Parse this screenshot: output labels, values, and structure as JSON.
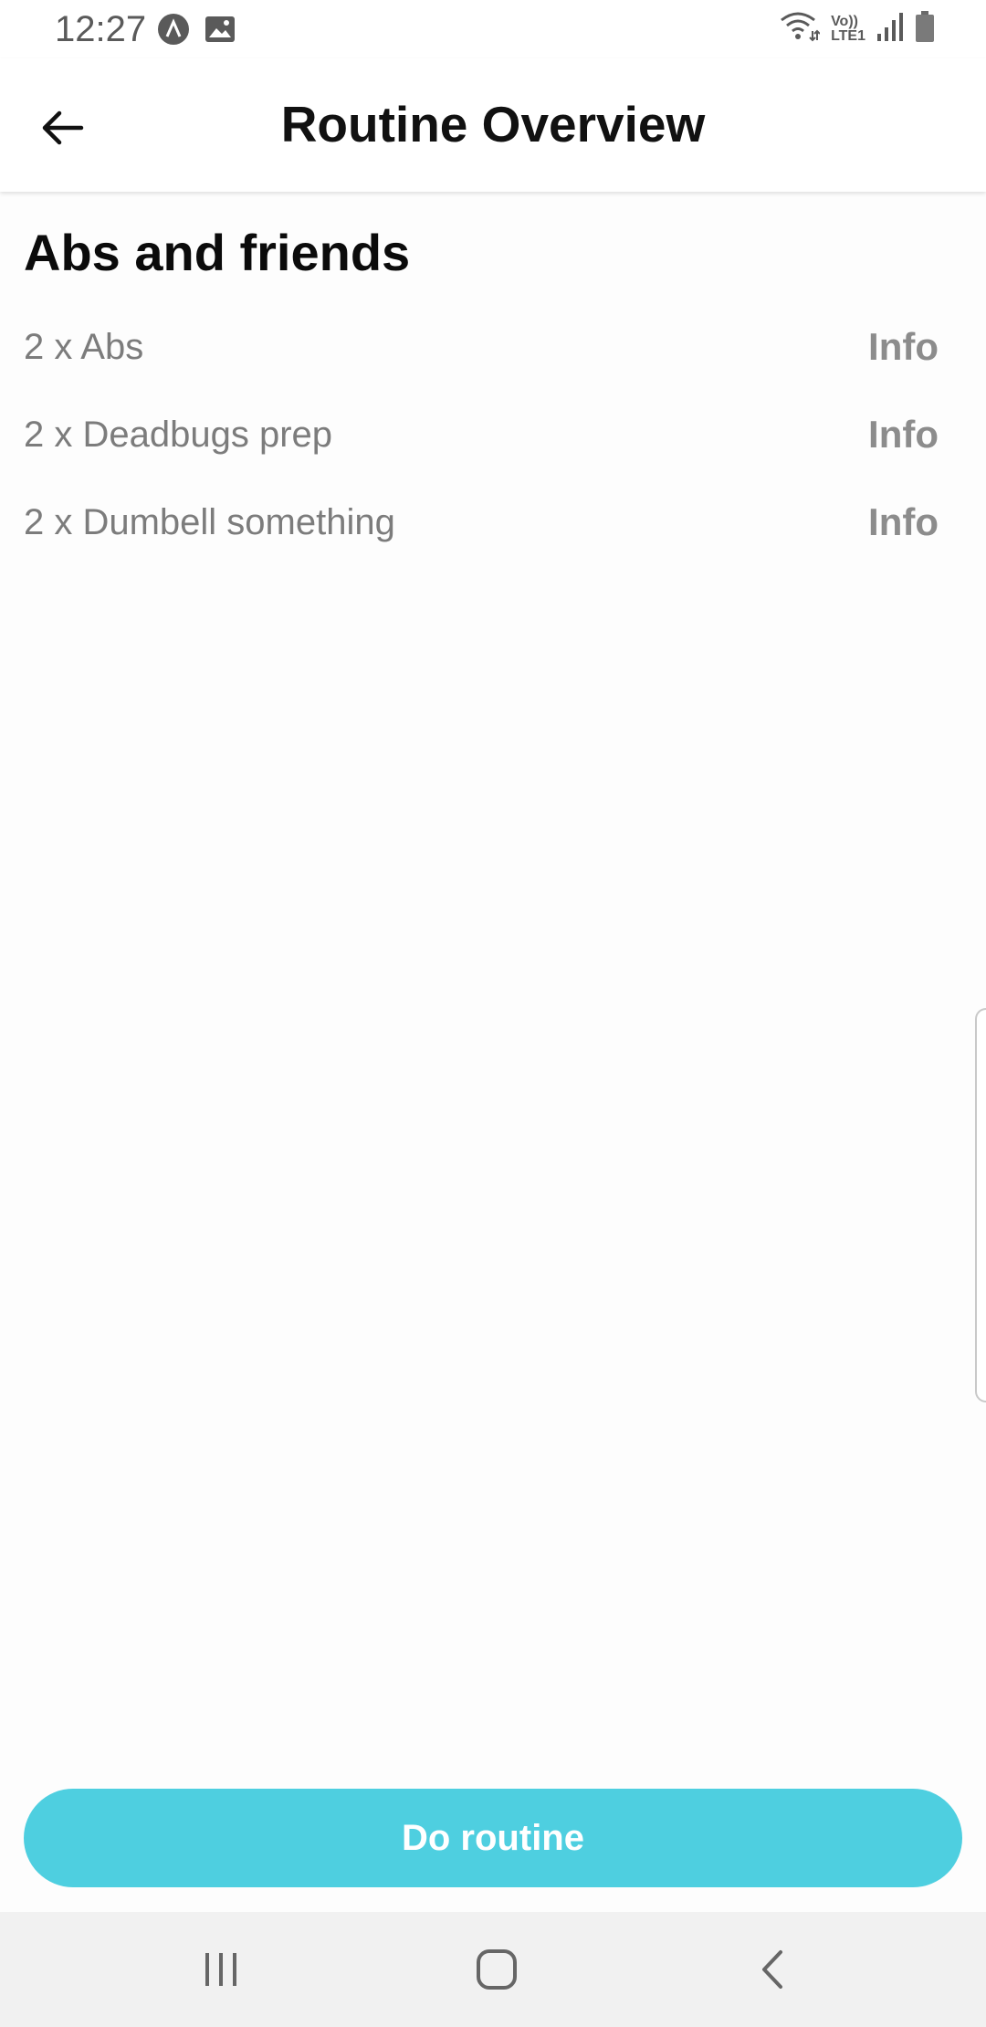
{
  "status_bar": {
    "time": "12:27",
    "left_icons": [
      "app-notification-icon",
      "image-icon"
    ],
    "right_icons": [
      "wifi-icon",
      "volte-lte-icon",
      "signal-icon",
      "battery-icon"
    ],
    "volte_text": "Vo))",
    "lte_text": "LTE1"
  },
  "app_bar": {
    "title": "Routine Overview",
    "back_icon": "arrow-left-icon"
  },
  "routine": {
    "name": "Abs and friends",
    "exercises": [
      {
        "label": "2 x Abs",
        "action": "Info"
      },
      {
        "label": "2 x Deadbugs prep",
        "action": "Info"
      },
      {
        "label": "2 x Dumbell something",
        "action": "Info"
      }
    ]
  },
  "primary_action": {
    "label": "Do routine",
    "color": "#4ecfe0"
  },
  "nav_bar": {
    "buttons": [
      "recent-apps-icon",
      "home-icon",
      "back-icon"
    ]
  }
}
